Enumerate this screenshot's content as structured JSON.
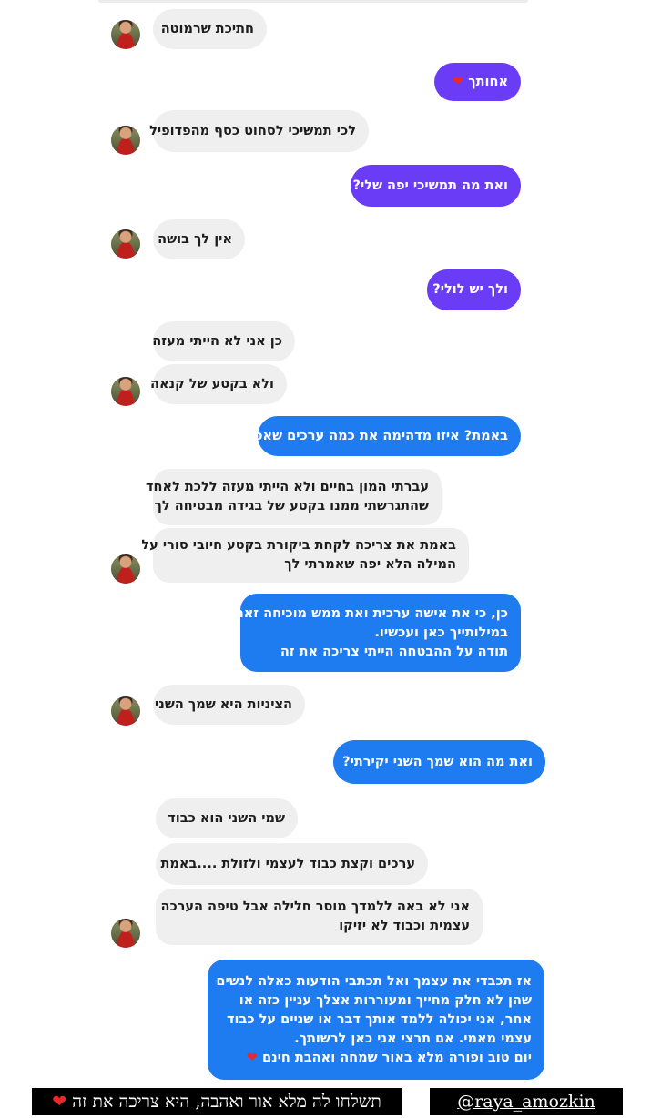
{
  "colors": {
    "incoming_bg": "#efefef",
    "outgoing_purple": "#6a3cf5",
    "outgoing_blue": "#1e7cf0",
    "heart": "#e62a2a"
  },
  "messages": [
    {
      "side": "in",
      "lines": [
        "חתיכת שרמוטה"
      ]
    },
    {
      "side": "out",
      "lines": [
        "אחותך"
      ],
      "heart": true
    },
    {
      "side": "in",
      "lines": [
        "לכי תמשיכי לסחוט כסף מהפדופיל"
      ]
    },
    {
      "side": "out",
      "lines": [
        "ואת מה תמשיכי יפה שלי?"
      ]
    },
    {
      "side": "in",
      "lines": [
        "אין לך בושה"
      ]
    },
    {
      "side": "out",
      "lines": [
        "ולך יש לולי?"
      ]
    },
    {
      "side": "in",
      "lines": [
        "כן אני לא הייתי מעזה"
      ]
    },
    {
      "side": "in",
      "lines": [
        "ולא בקטע של קנאה"
      ]
    },
    {
      "side": "out",
      "lines": [
        "באמת? איזו מדהימה את כמה ערכים שאפו"
      ]
    },
    {
      "side": "in",
      "lines": [
        "עברתי המון בחיים ולא הייתי מעזה ללכת לאחד",
        "שהתגרשתי ממנו בקטע של בגידה מבטיחה לך"
      ]
    },
    {
      "side": "in",
      "lines": [
        "באמת את צריכה לקחת ביקורת בקטע חיובי סורי על",
        "המילה הלא יפה שאמרתי לך"
      ]
    },
    {
      "side": "out",
      "lines": [
        "כן, כי את אישה ערכית ואת ממש מוכיחה זאת",
        "במילותייך כאן ועכשיו.",
        "תודה על ההבטחה הייתי צריכה את זה"
      ]
    },
    {
      "side": "in",
      "lines": [
        "הציניות היא שמך השני"
      ]
    },
    {
      "side": "out",
      "lines": [
        "ואת מה הוא שמך השני יקירתי?"
      ]
    },
    {
      "side": "in",
      "lines": [
        "שמי השני הוא כבוד"
      ]
    },
    {
      "side": "in",
      "lines": [
        "ערכים וקצת כבוד לעצמי ולזולת ....באמת"
      ]
    },
    {
      "side": "in",
      "lines": [
        "אני לא באה ללמדך מוסר חלילה אבל טיפה הערכה",
        "עצמית וכבוד לא יזיקו"
      ]
    },
    {
      "side": "out",
      "lines": [
        "אז תכבדי את עצמך ואל תכתבי הודעות כאלה לנשים",
        "שהן לא חלק מחייך ומעוררות אצלך עניין כזה או",
        "אחר, אני יכולה ללמד אותך דבר או שניים על כבוד",
        "עצמי מאמי. אם תרצי אני כאן לרשותך.",
        "יום טוב ופורה מלא באור שמחה ואהבת חינם"
      ],
      "heart": true
    }
  ],
  "caption": {
    "text": "תשלחו לה מלא אור ואהבה, היא צריכה את זה",
    "heart": "❤",
    "handle": "@raya_amozkin"
  }
}
